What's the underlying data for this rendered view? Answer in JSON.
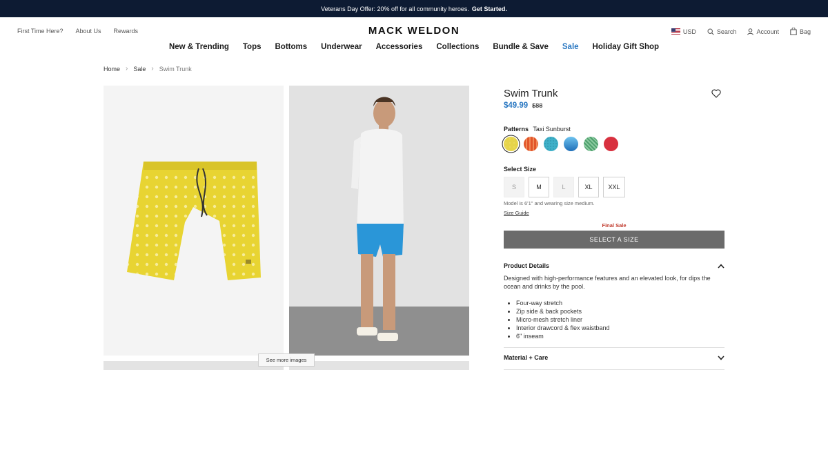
{
  "promo": {
    "text": "Veterans Day Offer: 20% off for all community heroes.",
    "cta": "Get Started."
  },
  "header": {
    "utility_left": [
      "First Time Here?",
      "About Us",
      "Rewards"
    ],
    "logo": "MACK WELDON",
    "currency": "USD",
    "search": "Search",
    "account": "Account",
    "bag": "Bag"
  },
  "nav": [
    "New & Trending",
    "Tops",
    "Bottoms",
    "Underwear",
    "Accessories",
    "Collections",
    "Bundle & Save",
    "Sale",
    "Holiday Gift Shop"
  ],
  "breadcrumb": [
    "Home",
    "Sale",
    "Swim Trunk"
  ],
  "gallery": {
    "see_more": "See more images"
  },
  "product": {
    "title": "Swim Trunk",
    "price": "$49.99",
    "original_price": "$88",
    "pattern_label": "Patterns",
    "pattern_selected": "Taxi Sunburst",
    "swatches": [
      {
        "name": "yellow",
        "color": "#e6d44a",
        "selected": true
      },
      {
        "name": "orange-stripe",
        "color": "#e2562a",
        "selected": false
      },
      {
        "name": "teal-dot",
        "color": "#3fb0c8",
        "selected": false
      },
      {
        "name": "blue-gradient",
        "color": "#2a8fd0",
        "selected": false
      },
      {
        "name": "green-pattern",
        "color": "#4ea06d",
        "selected": false
      },
      {
        "name": "red",
        "color": "#d8313f",
        "selected": false
      }
    ],
    "size_label": "Select Size",
    "sizes": [
      {
        "label": "S",
        "available": false
      },
      {
        "label": "M",
        "available": true
      },
      {
        "label": "L",
        "available": false
      },
      {
        "label": "XL",
        "available": true
      },
      {
        "label": "XXL",
        "available": true
      }
    ],
    "model_note": "Model is 6'1\" and wearing size medium.",
    "size_guide": "Size Guide",
    "final_sale": "Final Sale",
    "cta": "SELECT A SIZE",
    "details_title": "Product Details",
    "details_desc": "Designed with high-performance features and an elevated look, for dips the ocean and drinks by the pool.",
    "details_list": [
      "Four-way stretch",
      "Zip side & back pockets",
      "Micro-mesh stretch liner",
      "Interior drawcord & flex waistband",
      "6\" inseam"
    ],
    "material_title": "Material + Care"
  },
  "colors": {
    "promo_bg": "#0d1b33",
    "accent": "#2a78c2",
    "final_sale": "#c0392b",
    "cta_bg": "#6b6b6b"
  }
}
